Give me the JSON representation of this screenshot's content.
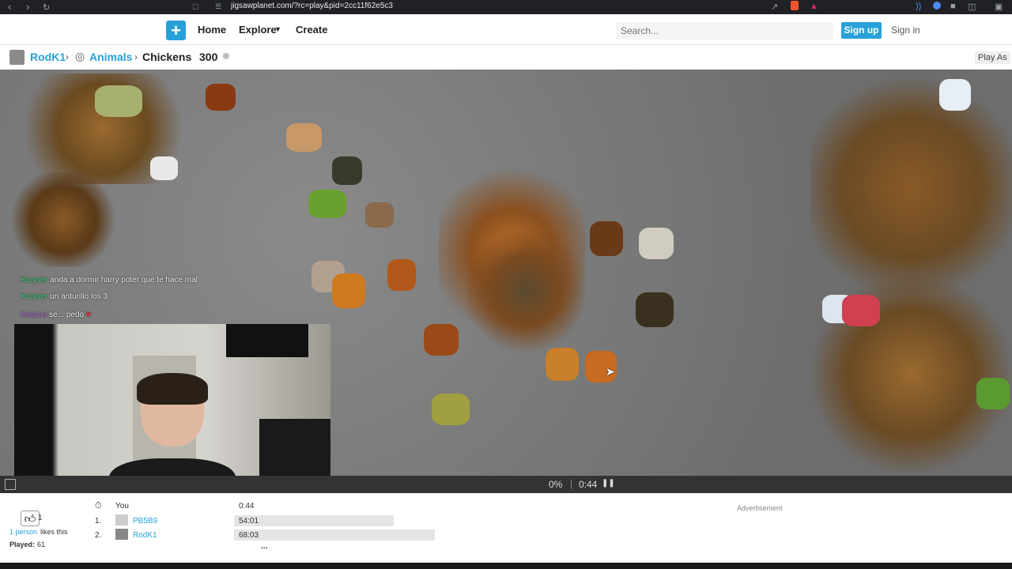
{
  "browser": {
    "url": "jigsawplanet.com/?rc=play&pid=2cc11f62e5c3",
    "back_icon": "back-arrow-icon",
    "forward_icon": "forward-arrow-icon",
    "reload_icon": "reload-icon"
  },
  "header": {
    "nav": [
      "Home",
      "Explore",
      "Create"
    ],
    "search_placeholder": "Search...",
    "signup_label": "Sign up",
    "signin_label": "Sign in"
  },
  "breadcrumb": {
    "user": "RodK1",
    "category": "Animals",
    "puzzle": "Chickens",
    "pieces": "300",
    "play_as": "Play As"
  },
  "chat": [
    {
      "name": "Kroyser",
      "message": "anda a dormir harry poter que te hace mal"
    },
    {
      "name": "Kroyser",
      "message": "un anturillo los 3"
    },
    {
      "name": "Kassuu",
      "message": "se... pedo"
    }
  ],
  "status": {
    "progress": "0%",
    "progress_value": 0,
    "time": "0:44"
  },
  "likes": {
    "count": "1",
    "likes_text_link": "1 person",
    "likes_text": "likes this",
    "played_label": "Played:",
    "played_count": "61"
  },
  "scores": {
    "you_label": "You",
    "you_time": "0:44",
    "rows": [
      {
        "rank": "1.",
        "name": "PB5B9",
        "time": "54:01"
      },
      {
        "rank": "2.",
        "name": "RodK1",
        "time": "68:03"
      }
    ],
    "more": "..."
  },
  "advertisement": "Advertisement",
  "colors": {
    "accent": "#27a1d8",
    "background_gray": "#7a7a7a"
  }
}
